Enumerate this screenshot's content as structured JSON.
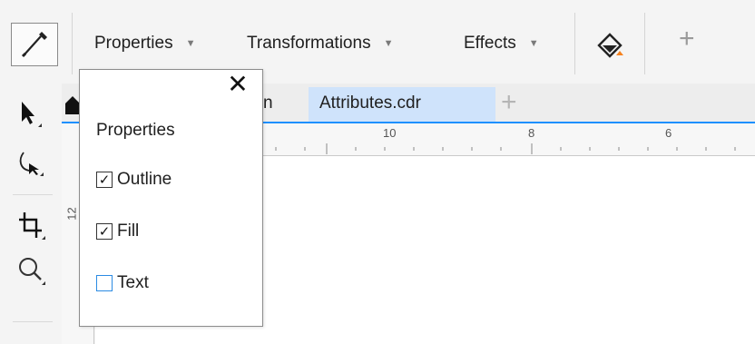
{
  "toolbar": {
    "eyedropper_icon": "eyedropper-icon",
    "menus": [
      {
        "label": "Properties"
      },
      {
        "label": "Transformations"
      },
      {
        "label": "Effects"
      }
    ],
    "caret": "▼",
    "apply_fill_icon": "paint-bucket-icon",
    "add_symbol": "+",
    "accent_color": "#f5821f"
  },
  "tabs": {
    "partial_label": "n",
    "active_label": "Attributes.cdr",
    "add_symbol": "+",
    "active_color": "#cfe3fb",
    "underline_color": "#1e90ff"
  },
  "ruler": {
    "h_labels": [
      "10",
      "8",
      "6"
    ],
    "v_label": "12"
  },
  "popup": {
    "close_symbol": "✕",
    "title": "Properties",
    "options": [
      {
        "label": "Outline",
        "checked": true
      },
      {
        "label": "Fill",
        "checked": true
      },
      {
        "label": "Text",
        "checked": false
      }
    ],
    "check_symbol": "✓"
  }
}
